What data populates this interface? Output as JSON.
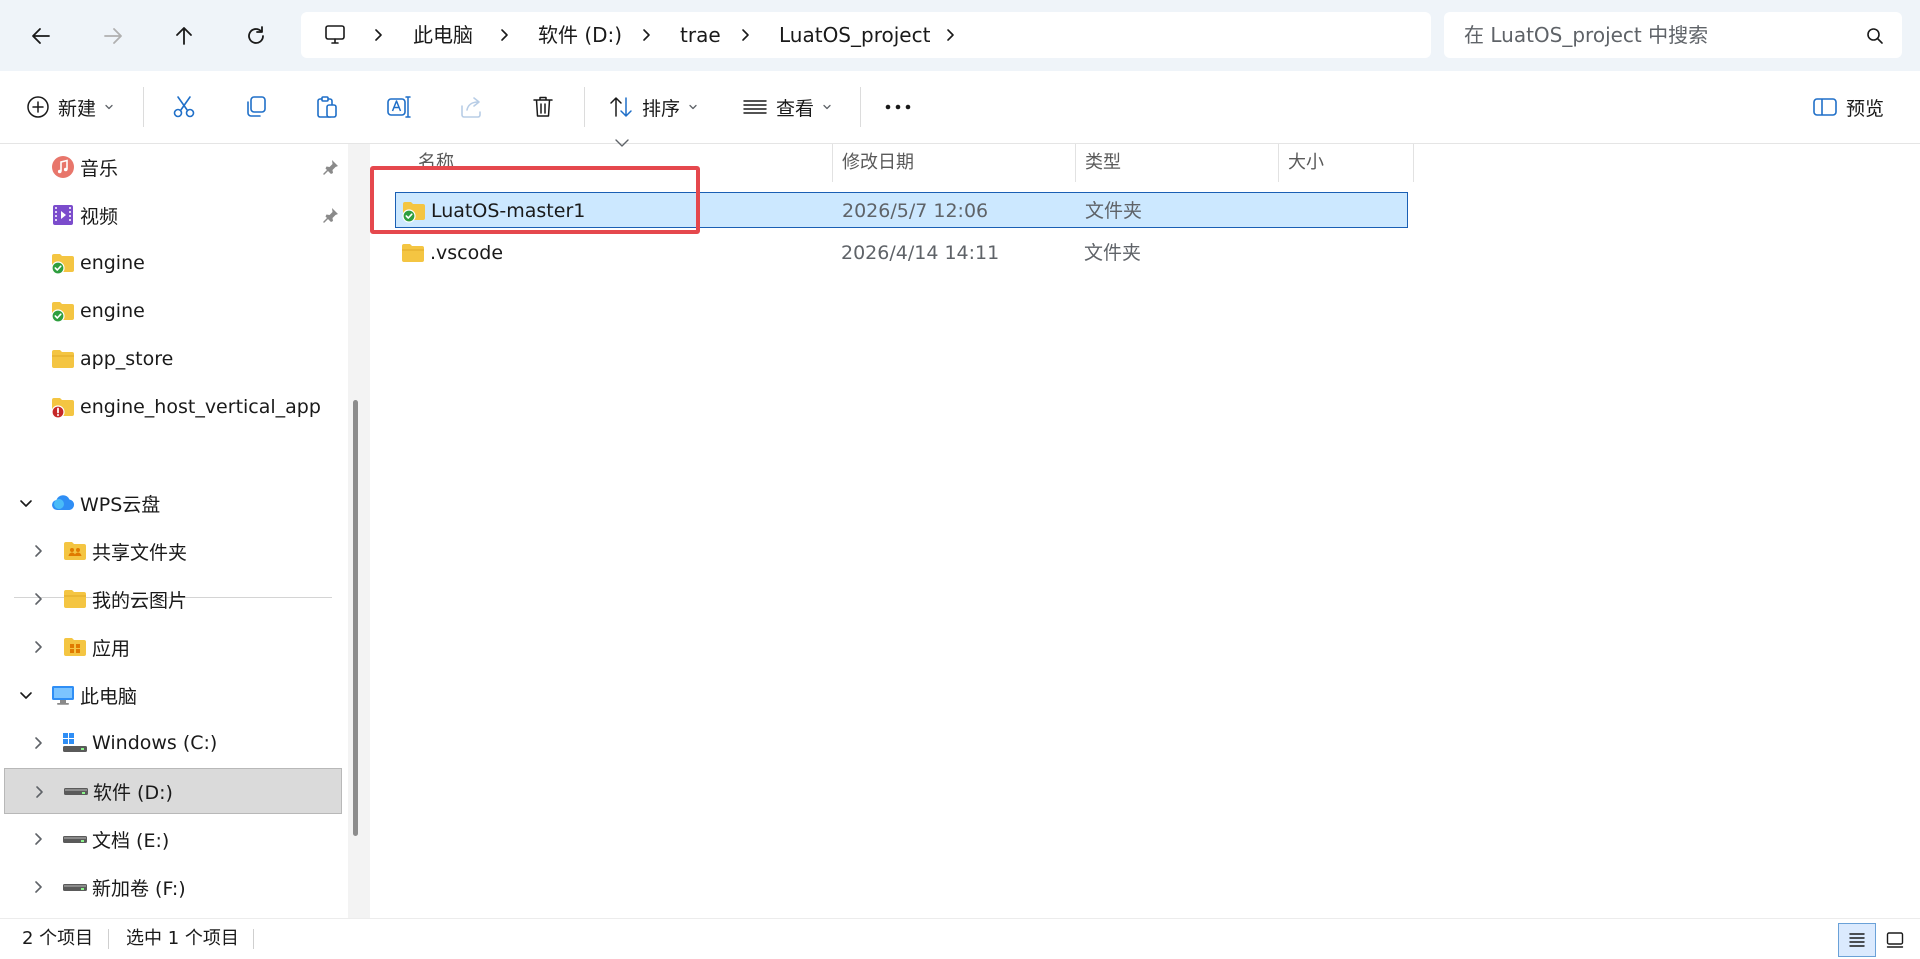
{
  "nav": {
    "back_icon": "arrow-left-icon",
    "forward_icon": "arrow-right-icon",
    "up_icon": "arrow-up-icon",
    "refresh_icon": "refresh-icon"
  },
  "address": {
    "breadcrumbs": [
      "此电脑",
      "软件 (D:)",
      "trae",
      "LuatOS_project"
    ]
  },
  "search": {
    "placeholder": "在 LuatOS_project 中搜索"
  },
  "toolbar": {
    "new_label": "新建",
    "sort_label": "排序",
    "view_label": "查看",
    "preview_label": "预览"
  },
  "sidebar": {
    "quick_access": [
      {
        "label": "音乐",
        "icon": "music-icon",
        "pinned": true
      },
      {
        "label": "视频",
        "icon": "video-icon",
        "pinned": true
      },
      {
        "label": "engine",
        "icon": "folder-synced-icon",
        "pinned": false
      },
      {
        "label": "engine",
        "icon": "folder-synced-icon",
        "pinned": false
      },
      {
        "label": "app_store",
        "icon": "folder-icon",
        "pinned": false
      },
      {
        "label": "engine_host_vertical_app",
        "icon": "folder-error-icon",
        "pinned": false
      }
    ],
    "wps": {
      "label": "WPS云盘",
      "children": [
        {
          "label": "共享文件夹",
          "icon": "shared-folder-icon"
        },
        {
          "label": "我的云图片",
          "icon": "folder-icon"
        },
        {
          "label": "应用",
          "icon": "apps-folder-icon"
        }
      ]
    },
    "this_pc": {
      "label": "此电脑",
      "drives": [
        {
          "label": "Windows (C:)",
          "icon": "windows-drive-icon",
          "selected": false
        },
        {
          "label": "软件 (D:)",
          "icon": "drive-icon",
          "selected": true
        },
        {
          "label": "文档 (E:)",
          "icon": "drive-icon",
          "selected": false
        },
        {
          "label": "新加卷 (F:)",
          "icon": "drive-icon",
          "selected": false
        }
      ]
    }
  },
  "file_list": {
    "columns": [
      "名称",
      "修改日期",
      "类型",
      "大小"
    ],
    "rows": [
      {
        "name": "LuatOS-master1",
        "modified": "2026/5/7 12:06",
        "type": "文件夹",
        "size": "",
        "selected": true,
        "icon": "folder-synced-icon"
      },
      {
        "name": ".vscode",
        "modified": "2026/4/14 14:11",
        "type": "文件夹",
        "size": "",
        "selected": false,
        "icon": "folder-icon"
      }
    ]
  },
  "status": {
    "item_count": "2 个项目",
    "selection": "选中 1 个项目"
  },
  "colors": {
    "accent": "#1a5fb4",
    "selection_fill": "#cce8ff",
    "annotation": "#e5484d",
    "folder": "#f4c542"
  }
}
